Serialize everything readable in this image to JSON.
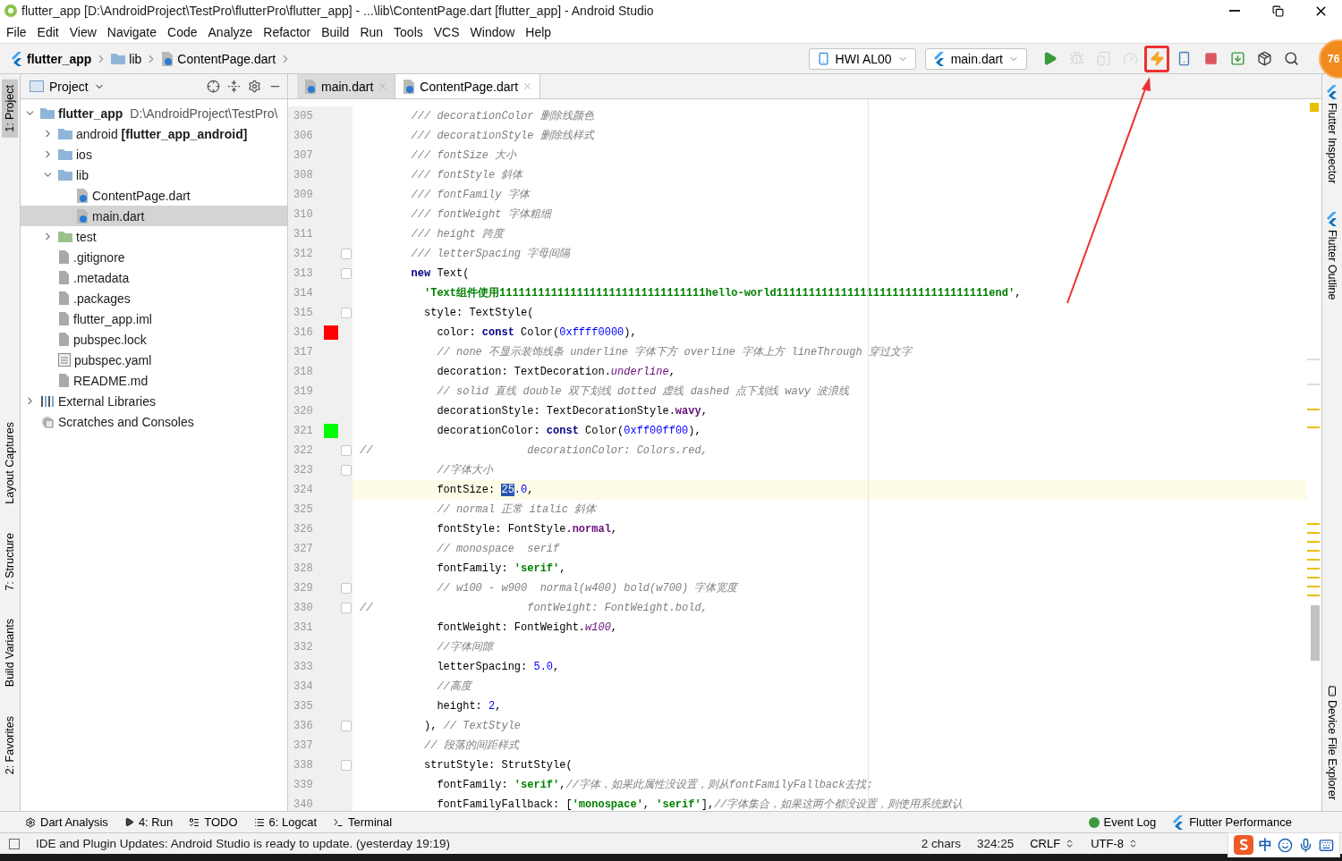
{
  "window": {
    "title": "flutter_app [D:\\AndroidProject\\TestPro\\flutterPro\\flutter_app] - ...\\lib\\ContentPage.dart [flutter_app] - Android Studio"
  },
  "menu": [
    "File",
    "Edit",
    "View",
    "Navigate",
    "Code",
    "Analyze",
    "Refactor",
    "Build",
    "Run",
    "Tools",
    "VCS",
    "Window",
    "Help"
  ],
  "breadcrumbs": [
    {
      "label": "flutter_app",
      "kind": "project"
    },
    {
      "label": "lib",
      "kind": "folder"
    },
    {
      "label": "ContentPage.dart",
      "kind": "dart"
    }
  ],
  "toolbar": {
    "device": "HWI AL00",
    "config": "main.dart",
    "buttons": [
      {
        "kind": "run",
        "disabled": false,
        "highlighted": false
      },
      {
        "kind": "debug",
        "disabled": true,
        "highlighted": false
      },
      {
        "kind": "attach",
        "disabled": true,
        "highlighted": false
      },
      {
        "kind": "profile",
        "disabled": true,
        "highlighted": false
      },
      {
        "kind": "hot-reload",
        "disabled": false,
        "highlighted": true
      },
      {
        "kind": "hot-restart",
        "disabled": false,
        "highlighted": false
      },
      {
        "kind": "stop",
        "disabled": false,
        "highlighted": false
      },
      {
        "kind": "sync",
        "disabled": false,
        "highlighted": false
      },
      {
        "kind": "sdk",
        "disabled": false,
        "highlighted": false
      },
      {
        "kind": "search",
        "disabled": false,
        "highlighted": false
      }
    ]
  },
  "floating_badge": "76",
  "left_strip": [
    {
      "label": "1: Project",
      "selected": true
    },
    {
      "label": "Layout Captures",
      "selected": false
    },
    {
      "label": "7: Structure",
      "selected": false
    },
    {
      "label": "Build Variants",
      "selected": false
    },
    {
      "label": "2: Favorites",
      "selected": false
    }
  ],
  "right_strip": [
    "Flutter Inspector",
    "Flutter Outline",
    "Device File Explorer"
  ],
  "project_panel": {
    "title": "Project",
    "tree": [
      {
        "label": "**flutter_app**",
        "detail": "D:\\AndroidProject\\TestPro\\",
        "kind": "project",
        "expanded": true,
        "selected": false,
        "children": [
          {
            "label": "android **[flutter_app_android]**",
            "kind": "module",
            "expanded": false,
            "selected": false
          },
          {
            "label": "ios",
            "kind": "folder",
            "expanded": false,
            "selected": false
          },
          {
            "label": "lib",
            "kind": "folder-open",
            "expanded": true,
            "selected": false,
            "children": [
              {
                "label": "ContentPage.dart",
                "kind": "dart",
                "selected": false
              },
              {
                "label": "main.dart",
                "kind": "dart",
                "selected": true
              }
            ]
          },
          {
            "label": "test",
            "kind": "test-folder",
            "expanded": false,
            "selected": false
          },
          {
            "label": ".gitignore",
            "kind": "file",
            "selected": false
          },
          {
            "label": ".metadata",
            "kind": "file",
            "selected": false
          },
          {
            "label": ".packages",
            "kind": "file",
            "selected": false
          },
          {
            "label": "flutter_app.iml",
            "kind": "module-file",
            "selected": false
          },
          {
            "label": "pubspec.lock",
            "kind": "file",
            "selected": false
          },
          {
            "label": "pubspec.yaml",
            "kind": "yaml",
            "selected": false
          },
          {
            "label": "README.md",
            "kind": "file",
            "selected": false
          }
        ]
      },
      {
        "label": "External Libraries",
        "kind": "library",
        "expanded": false,
        "selected": false
      },
      {
        "label": "Scratches and Consoles",
        "kind": "scratches",
        "selected": false
      }
    ]
  },
  "editor_tabs": [
    {
      "label": "main.dart",
      "selected": false
    },
    {
      "label": "ContentPage.dart",
      "selected": true
    }
  ],
  "code": [
    {
      "number": "305",
      "tokens": [
        {
          "kind": "comment",
          "text": "        /// decorationColor 删除线颜色"
        }
      ]
    },
    {
      "number": "306",
      "tokens": [
        {
          "kind": "comment",
          "text": "        /// decorationStyle 删除线样式"
        }
      ]
    },
    {
      "number": "307",
      "tokens": [
        {
          "kind": "comment",
          "text": "        /// fontSize 大小"
        }
      ]
    },
    {
      "number": "308",
      "tokens": [
        {
          "kind": "comment",
          "text": "        /// fontStyle 斜体"
        }
      ]
    },
    {
      "number": "309",
      "tokens": [
        {
          "kind": "comment",
          "text": "        /// fontFamily 字体"
        }
      ]
    },
    {
      "number": "310",
      "tokens": [
        {
          "kind": "comment",
          "text": "        /// fontWeight 字体粗细"
        }
      ]
    },
    {
      "number": "311",
      "tokens": [
        {
          "kind": "comment",
          "text": "        /// height 跨度"
        }
      ]
    },
    {
      "number": "312",
      "fold": true,
      "tokens": [
        {
          "kind": "comment",
          "text": "        /// letterSpacing 字母间隔"
        }
      ]
    },
    {
      "number": "313",
      "fold": true,
      "tokens": [
        {
          "kind": "keyword",
          "text": "        new"
        },
        {
          "kind": "plain",
          "text": " Text("
        }
      ]
    },
    {
      "number": "314",
      "tokens": [
        {
          "kind": "string",
          "text": "          'Text组件使用11111111111111111111111111111111hello-world111111111111111111111111111111111end'"
        },
        {
          "kind": "plain",
          "text": ","
        }
      ]
    },
    {
      "number": "315",
      "fold": true,
      "tokens": [
        {
          "kind": "plain",
          "text": "          style: TextStyle("
        }
      ]
    },
    {
      "number": "316",
      "color": "#ff0000",
      "tokens": [
        {
          "kind": "plain",
          "text": "            color: "
        },
        {
          "kind": "keyword",
          "text": "const"
        },
        {
          "kind": "plain",
          "text": " Color("
        },
        {
          "kind": "number",
          "text": "0xffff0000"
        },
        {
          "kind": "plain",
          "text": "),"
        }
      ]
    },
    {
      "number": "317",
      "tokens": [
        {
          "kind": "comment",
          "text": "            // none 不显示装饰线条 underline 字体下方 overline 字体上方 lineThrough 穿过文字"
        }
      ]
    },
    {
      "number": "318",
      "tokens": [
        {
          "kind": "plain",
          "text": "            decoration: TextDecoration."
        },
        {
          "kind": "field-italic",
          "text": "underline"
        },
        {
          "kind": "plain",
          "text": ","
        }
      ]
    },
    {
      "number": "319",
      "tokens": [
        {
          "kind": "comment",
          "text": "            // solid 直线 double 双下划线 dotted 虚线 dashed 点下划线 wavy 波浪线"
        }
      ]
    },
    {
      "number": "320",
      "tokens": [
        {
          "kind": "plain",
          "text": "            decorationStyle: TextDecorationStyle."
        },
        {
          "kind": "field",
          "text": "wavy"
        },
        {
          "kind": "plain",
          "text": ","
        }
      ]
    },
    {
      "number": "321",
      "color": "#00ff00",
      "tokens": [
        {
          "kind": "plain",
          "text": "            decorationColor: "
        },
        {
          "kind": "keyword",
          "text": "const"
        },
        {
          "kind": "plain",
          "text": " Color("
        },
        {
          "kind": "number",
          "text": "0xff00ff00"
        },
        {
          "kind": "plain",
          "text": "),"
        }
      ]
    },
    {
      "number": "322",
      "fold": true,
      "tokens": [
        {
          "kind": "comment",
          "text": "//                        decorationColor: Colors.red,"
        }
      ]
    },
    {
      "number": "323",
      "fold": true,
      "tokens": [
        {
          "kind": "comment",
          "text": "            //字体大小"
        }
      ]
    },
    {
      "number": "324",
      "current": true,
      "tokens": [
        {
          "kind": "plain",
          "text": "            fontSize: "
        },
        {
          "kind": "selection",
          "text": "25"
        },
        {
          "kind": "number",
          "text": ".0"
        },
        {
          "kind": "plain",
          "text": ","
        }
      ]
    },
    {
      "number": "325",
      "tokens": [
        {
          "kind": "comment",
          "text": "            // normal 正常 italic 斜体"
        }
      ]
    },
    {
      "number": "326",
      "tokens": [
        {
          "kind": "plain",
          "text": "            fontStyle: FontStyle."
        },
        {
          "kind": "field",
          "text": "normal"
        },
        {
          "kind": "plain",
          "text": ","
        }
      ]
    },
    {
      "number": "327",
      "tokens": [
        {
          "kind": "comment",
          "text": "            // monospace  serif"
        }
      ]
    },
    {
      "number": "328",
      "tokens": [
        {
          "kind": "plain",
          "text": "            fontFamily: "
        },
        {
          "kind": "string",
          "text": "'serif'"
        },
        {
          "kind": "plain",
          "text": ","
        }
      ]
    },
    {
      "number": "329",
      "fold": true,
      "tokens": [
        {
          "kind": "comment",
          "text": "            // w100 - w900  normal(w400) bold(w700) 字体宽度"
        }
      ]
    },
    {
      "number": "330",
      "fold": true,
      "tokens": [
        {
          "kind": "comment",
          "text": "//                        fontWeight: FontWeight.bold,"
        }
      ]
    },
    {
      "number": "331",
      "tokens": [
        {
          "kind": "plain",
          "text": "            fontWeight: FontWeight."
        },
        {
          "kind": "field-italic",
          "text": "w100"
        },
        {
          "kind": "plain",
          "text": ","
        }
      ]
    },
    {
      "number": "332",
      "tokens": [
        {
          "kind": "comment",
          "text": "            //字体间隙"
        }
      ]
    },
    {
      "number": "333",
      "tokens": [
        {
          "kind": "plain",
          "text": "            letterSpacing: "
        },
        {
          "kind": "number",
          "text": "5.0"
        },
        {
          "kind": "plain",
          "text": ","
        }
      ]
    },
    {
      "number": "334",
      "tokens": [
        {
          "kind": "comment",
          "text": "            //高度"
        }
      ]
    },
    {
      "number": "335",
      "tokens": [
        {
          "kind": "plain",
          "text": "            height: "
        },
        {
          "kind": "number",
          "text": "2"
        },
        {
          "kind": "plain",
          "text": ","
        }
      ]
    },
    {
      "number": "336",
      "fold": true,
      "tokens": [
        {
          "kind": "plain",
          "text": "          ), "
        },
        {
          "kind": "comment",
          "text": "// TextStyle"
        }
      ]
    },
    {
      "number": "337",
      "tokens": [
        {
          "kind": "comment",
          "text": "          // 段落的间距样式"
        }
      ]
    },
    {
      "number": "338",
      "fold": true,
      "tokens": [
        {
          "kind": "plain",
          "text": "          strutStyle: StrutStyle("
        }
      ]
    },
    {
      "number": "339",
      "tokens": [
        {
          "kind": "plain",
          "text": "            fontFamily: "
        },
        {
          "kind": "string",
          "text": "'serif'"
        },
        {
          "kind": "plain",
          "text": ","
        },
        {
          "kind": "comment",
          "text": "//字体，如果此属性没设置，则从fontFamilyFallback去找;"
        }
      ]
    },
    {
      "number": "340",
      "tokens": [
        {
          "kind": "plain",
          "text": "            fontFamilyFallback: ["
        },
        {
          "kind": "string",
          "text": "'monospace'"
        },
        {
          "kind": "plain",
          "text": ", "
        },
        {
          "kind": "string",
          "text": "'serif'"
        },
        {
          "kind": "plain",
          "text": "],"
        },
        {
          "kind": "comment",
          "text": "//字体集合，如果这两个都没设置，则使用系统默认"
        }
      ]
    }
  ],
  "tool_windows": [
    {
      "label": "Dart Analysis",
      "kind": "analysis"
    },
    {
      "label": "4: Run",
      "kind": "run"
    },
    {
      "label": "TODO",
      "kind": "todo"
    },
    {
      "label": "6: Logcat",
      "kind": "logcat"
    },
    {
      "label": "Terminal",
      "kind": "terminal"
    }
  ],
  "tool_windows_right": [
    {
      "label": "Event Log",
      "kind": "event"
    },
    {
      "label": "Flutter Performance",
      "kind": "flutter"
    }
  ],
  "status_bar": {
    "message": "IDE and Plugin Updates: Android Studio is ready to update. (yesterday 19:19)",
    "items": [
      {
        "label": "2 chars",
        "kind": "text"
      },
      {
        "label": "324:25",
        "kind": "text"
      },
      {
        "label": "CRLF",
        "kind": "select"
      },
      {
        "label": "UTF-8",
        "kind": "select"
      }
    ]
  },
  "ime_bar": {
    "mode": "中"
  }
}
